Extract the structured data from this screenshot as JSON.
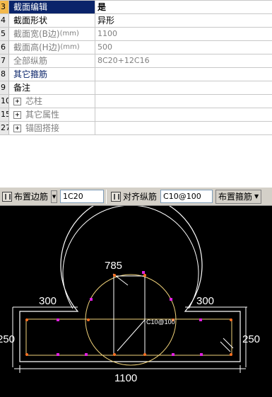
{
  "properties": [
    {
      "num": "3",
      "name": "截面编辑",
      "value": "是",
      "style": "selected"
    },
    {
      "num": "4",
      "name": "截面形状",
      "value": "异形",
      "style": "normal"
    },
    {
      "num": "5",
      "name": "截面宽(B边)",
      "unit": "(mm)",
      "value": "1100",
      "style": "gray"
    },
    {
      "num": "6",
      "name": "截面高(H边)",
      "unit": "(mm)",
      "value": "500",
      "style": "gray"
    },
    {
      "num": "7",
      "name": "全部纵筋",
      "value": "8C20+12C16",
      "style": "gray"
    },
    {
      "num": "8",
      "name": "其它箍筋",
      "value": "",
      "style": "blue"
    },
    {
      "num": "9",
      "name": "备注",
      "value": "",
      "style": "normal"
    },
    {
      "num": "10",
      "name": "芯柱",
      "value": "",
      "style": "group"
    },
    {
      "num": "15",
      "name": "其它属性",
      "value": "",
      "style": "group"
    },
    {
      "num": "27",
      "name": "锚固搭接",
      "value": "",
      "style": "group"
    }
  ],
  "toolbar": {
    "edge_rebar_label": "布置边筋",
    "edge_rebar_value": "1C20",
    "align_rebar_label": "对齐纵筋",
    "stirrup_value": "C10@100",
    "stirrup_label": "布置箍筋"
  },
  "drawing": {
    "dim_arc": "785",
    "dim_left_top": "300",
    "dim_right_top": "300",
    "dim_left_height": "250",
    "dim_right_height": "250",
    "dim_bottom": "1100",
    "stirrup_text": "C10@100",
    "colors": {
      "background": "#000000",
      "section_outline": "#ffffff",
      "stirrup": "#f0d27a",
      "rebar_main": "#ff7020",
      "rebar_edge": "#e020e0",
      "dimension": "#ffffff"
    }
  }
}
